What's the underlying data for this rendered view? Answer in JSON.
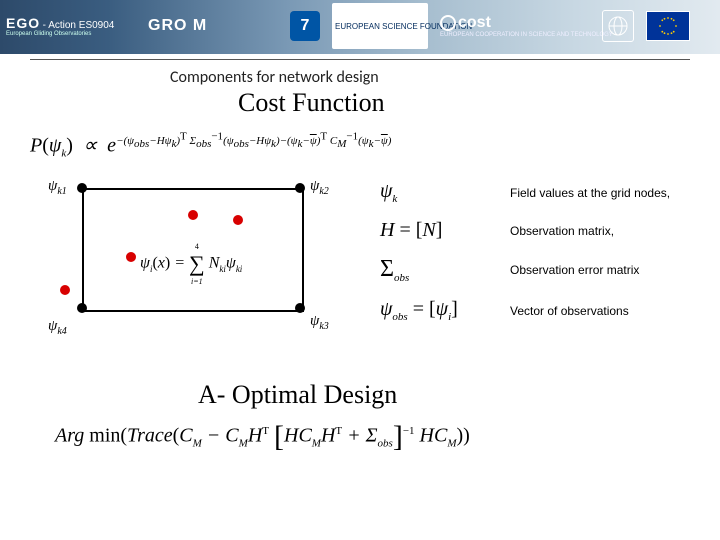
{
  "header": {
    "ego": {
      "title": "EGO",
      "action": "- Action ES0904",
      "sub": "European Gliding Observatories"
    },
    "groom": "GRO   M",
    "fp": "7",
    "esf": "EUROPEAN SCIENCE FOUNDATION",
    "cost": {
      "brand": "cost",
      "tag": "EUROPEAN COOPERATION IN SCIENCE AND TECHNOLOGY"
    }
  },
  "subhead": "Components for network design",
  "title1": "Cost Function",
  "formula_main": "P(ψ_k) ∝ e^{ −(ψ_obs − Hψ_k)^T Σ_obs^{−1} (ψ_obs − Hψ_k) − (ψ_k − ψ̄)^T C_M^{−1} (ψ_k − ψ̄) }",
  "diagram": {
    "psi_k1": "ψ",
    "psi_k1_sub": "k1",
    "psi_k2": "ψ",
    "psi_k2_sub": "k2",
    "psi_k3": "ψ",
    "psi_k3_sub": "k3",
    "psi_k4": "ψ",
    "psi_k4_sub": "k4",
    "psi_i_eq": "ψ_i (x) = Σ_{i=1}^{4} N_{ki} ψ_{ki}"
  },
  "defs": {
    "row1": {
      "sym": "ψ",
      "sym_sub": "k",
      "txt": "Field values at the grid nodes,"
    },
    "row2": {
      "sym_full": "H = [N]",
      "txt": "Observation  matrix,"
    },
    "row3": {
      "sym": "Σ",
      "sym_sub": "obs",
      "txt": "Observation  error matrix"
    },
    "row4": {
      "sym_full": "ψ_obs = [ψ_i]",
      "txt": "Vector of observations"
    }
  },
  "title2": "A- Optimal Design",
  "formula_opt": "Arg min( Trace( C_M − C_M H^T [ H C_M H^T + Σ_obs ]^{−1} H C_M ) )"
}
